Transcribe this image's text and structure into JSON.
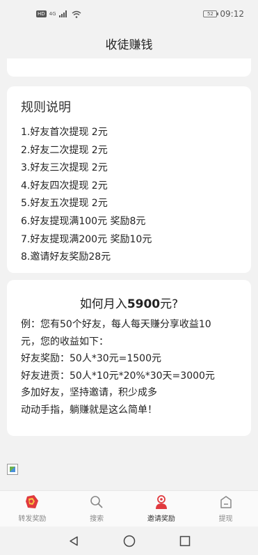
{
  "status_bar": {
    "hd": "HD",
    "network": "4G",
    "battery": "52",
    "time": "09:12"
  },
  "header": {
    "title": "收徒赚钱"
  },
  "rules": {
    "title": "规则说明",
    "items": [
      "1.好友首次提现 2元",
      "2.好友二次提现 2元",
      "3.好友三次提现 2元",
      "4.好友四次提现 2元",
      "5.好友五次提现 2元",
      "6.好友提现满100元 奖励8元",
      "7.好友提现满200元 奖励10元",
      "8.邀请好友奖励28元"
    ]
  },
  "earn": {
    "title_prefix": "如何月入",
    "title_amount": "5900",
    "title_suffix": "元?",
    "lines": [
      "例：您有50个好友，每人每天赚分享收益10",
      "元，您的收益如下：",
      "好友奖励：50人*30元=1500元",
      "好友进贡：50人*10元*20%*30天=3000元",
      "多加好友，坚持邀请，积少成多",
      "动动手指，躺赚就是这么简单！"
    ]
  },
  "tabbar": {
    "tabs": [
      {
        "label": "转发奖励",
        "icon": "red-envelope-icon"
      },
      {
        "label": "搜索",
        "icon": "search-icon"
      },
      {
        "label": "邀请奖励",
        "icon": "invite-user-icon"
      },
      {
        "label": "提现",
        "icon": "wallet-icon"
      }
    ],
    "active_index": 2
  },
  "colors": {
    "accent_red": "#e0393e",
    "background": "#f2f2f2",
    "card": "#ffffff"
  }
}
